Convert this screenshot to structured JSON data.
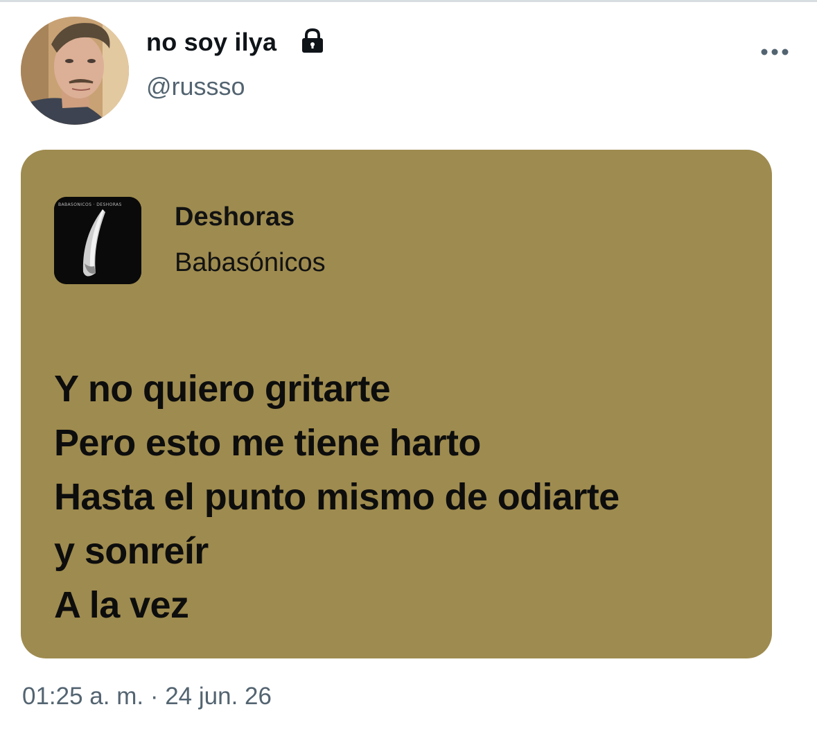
{
  "tweet": {
    "author": {
      "display_name": "no soy ilya",
      "handle": "@russso",
      "protected_icon": "lock-icon",
      "avatar_icon": "user-avatar-photo"
    },
    "more_icon": "more-horizontal-icon",
    "lyrics_card": {
      "background_color": "#9e8b4f",
      "album_art_text": "BABASÓNICOS · DESHORAS",
      "song_title": "Deshoras",
      "artist": "Babasónicos",
      "lines": [
        "Y no quiero gritarte",
        "Pero esto me tiene harto",
        "Hasta el punto mismo de odiarte",
        "y sonreír",
        "A la vez"
      ]
    },
    "timestamp": "01:25 a. m. · 24 jun. 26"
  },
  "colors": {
    "text_primary": "#0f1419",
    "text_secondary": "#536471",
    "card": "#9e8b4f"
  }
}
